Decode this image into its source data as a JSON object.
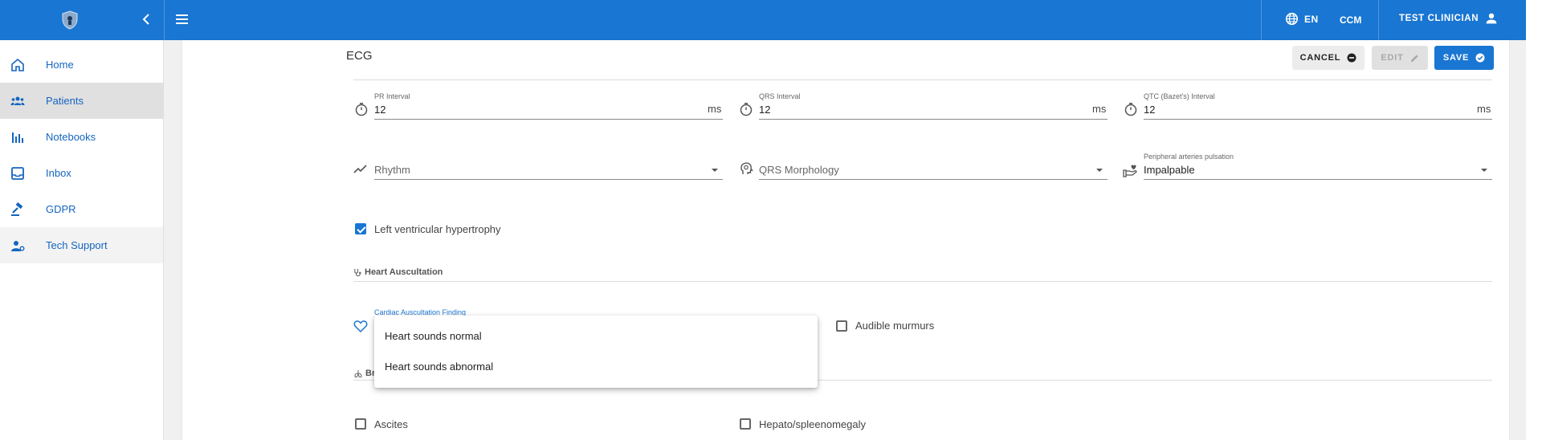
{
  "topbar": {
    "logo_icon": "shield-logo-icon",
    "collapse_icon": "chevron-left-icon",
    "menu_icon": "hamburger-menu-icon",
    "language": "EN",
    "tenant": "CCM",
    "user_name": "TEST CLINICIAN",
    "accent_color": "#1976d2"
  },
  "sidebar": {
    "items": [
      {
        "label": "Home",
        "icon": "home-icon"
      },
      {
        "label": "Patients",
        "icon": "people-icon",
        "active": true
      },
      {
        "label": "Notebooks",
        "icon": "bar-chart-icon"
      },
      {
        "label": "Inbox",
        "icon": "inbox-icon"
      },
      {
        "label": "GDPR",
        "icon": "gavel-icon"
      },
      {
        "label": "Tech Support",
        "icon": "support-agent-icon"
      }
    ]
  },
  "form": {
    "title": "ECG",
    "actions": {
      "cancel": "CANCEL",
      "edit": "EDIT",
      "save": "SAVE"
    },
    "intervals": [
      {
        "label": "PR Interval",
        "value": "12",
        "unit": "ms"
      },
      {
        "label": "QRS Interval",
        "value": "12",
        "unit": "ms"
      },
      {
        "label": "QTC (Bazet's) Interval",
        "value": "12",
        "unit": "ms"
      }
    ],
    "rhythm": {
      "placeholder": "Rhythm"
    },
    "qrs_morphology": {
      "placeholder": "QRS Morphology"
    },
    "peripheral": {
      "label": "Peripheral arteries pulsation",
      "value": "Impalpable"
    },
    "lvh": {
      "label": "Left ventricular hypertrophy",
      "checked": true
    },
    "heart_auscultation": {
      "title": "Heart Auscultation",
      "finding_label": "Cardiac Auscultation Finding",
      "murmurs_label": "Audible murmurs",
      "murmurs_checked": false
    },
    "next_section_fragment": "Br",
    "abdomen": {
      "ascites": "Ascites",
      "hepato": "Hepato/spleenomegaly"
    }
  },
  "dropdown": {
    "options": [
      "Heart sounds normal",
      "Heart sounds abnormal"
    ]
  }
}
